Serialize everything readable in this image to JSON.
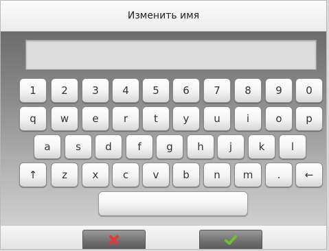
{
  "title": "Изменить имя",
  "input": {
    "value": "",
    "placeholder": ""
  },
  "keyboard": {
    "row1": [
      "1",
      "2",
      "3",
      "4",
      "5",
      "6",
      "7",
      "8",
      "9",
      "0"
    ],
    "row2": [
      "q",
      "w",
      "e",
      "r",
      "t",
      "y",
      "u",
      "i",
      "o",
      "p"
    ],
    "row3": [
      "a",
      "s",
      "d",
      "f",
      "g",
      "h",
      "j",
      "k",
      "l"
    ],
    "row4": [
      "↑",
      "z",
      "x",
      "c",
      "v",
      "b",
      "n",
      "m",
      ".",
      "←"
    ]
  },
  "buttons": {
    "cancel_icon": "red-x-icon",
    "confirm_icon": "green-check-icon"
  },
  "colors": {
    "cancel": "#e53935",
    "confirm": "#6cc12e"
  }
}
